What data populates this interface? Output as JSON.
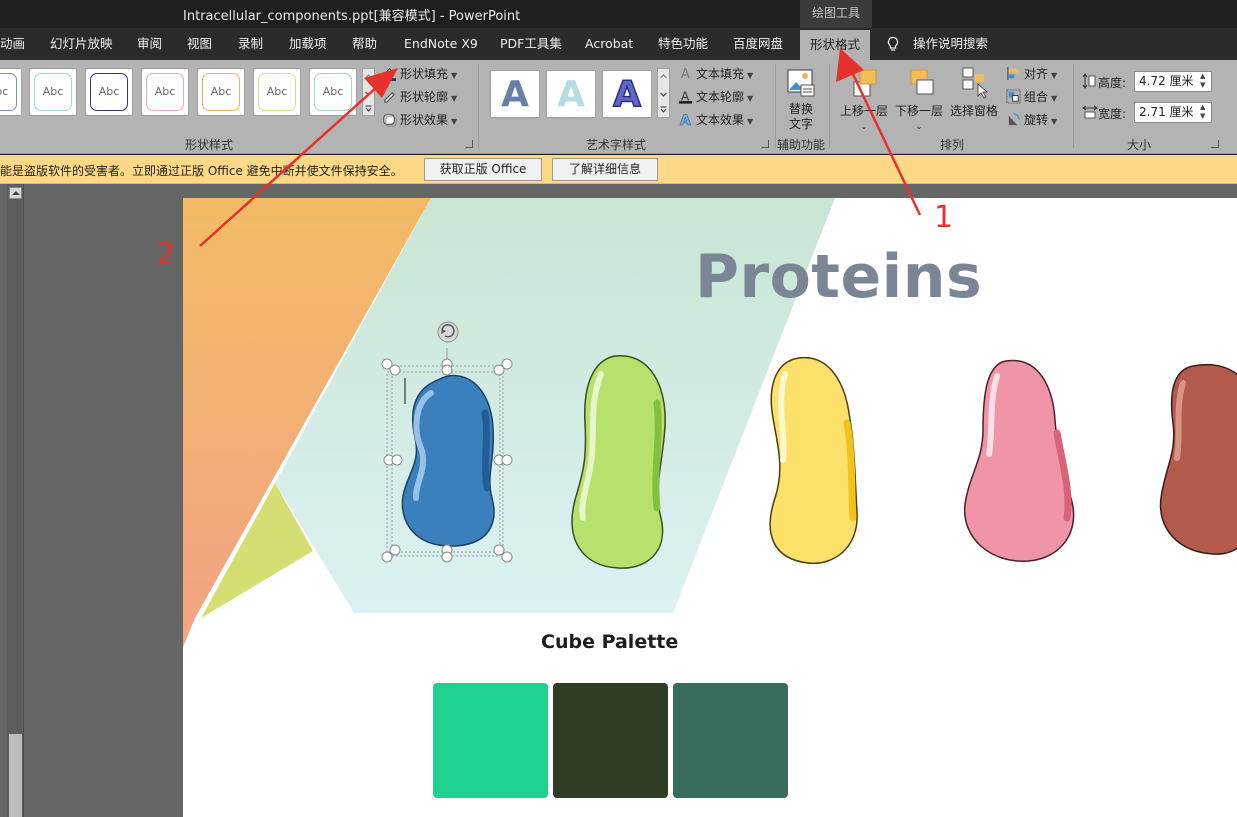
{
  "window": {
    "title": "Intracellular_components.ppt[兼容模式]  -  PowerPoint",
    "context_group": "绘图工具"
  },
  "tabs": [
    {
      "label": "动画",
      "active": false
    },
    {
      "label": "幻灯片放映",
      "active": false
    },
    {
      "label": "审阅",
      "active": false
    },
    {
      "label": "视图",
      "active": false
    },
    {
      "label": "录制",
      "active": false
    },
    {
      "label": "加载项",
      "active": false
    },
    {
      "label": "帮助",
      "active": false
    },
    {
      "label": "EndNote X9",
      "active": false
    },
    {
      "label": "PDF工具集",
      "active": false
    },
    {
      "label": "Acrobat",
      "active": false
    },
    {
      "label": "特色功能",
      "active": false
    },
    {
      "label": "百度网盘",
      "active": false
    },
    {
      "label": "形状格式",
      "active": true
    }
  ],
  "tell_me": "操作说明搜索",
  "ribbon": {
    "shape_styles": {
      "label": "形状样式",
      "swatch_text": "Abc",
      "swatch_colors": [
        "#7b8fc7",
        "#9ed3dc",
        "#2f3580",
        "#f0a7b2",
        "#f2b25a",
        "#d7e07c",
        "#a8d3ba"
      ],
      "fill": "形状填充",
      "outline": "形状轮廓",
      "effects": "形状效果"
    },
    "wordart_styles": {
      "label": "艺术字样式",
      "letter": "A",
      "text_fill": "文本填充",
      "text_outline": "文本轮廓",
      "text_effects": "文本效果"
    },
    "accessibility": {
      "label": "辅助功能",
      "alt_text_line1": "替换",
      "alt_text_line2": "文字"
    },
    "arrange": {
      "label": "排列",
      "bring_forward": "上移一层",
      "send_backward": "下移一层",
      "selection_pane": "选择窗格",
      "align": "对齐",
      "group": "组合",
      "rotate": "旋转"
    },
    "size": {
      "label": "大小",
      "height_label": "高度:",
      "height_value": "4.72 厘米",
      "width_label": "宽度:",
      "width_value": "2.71 厘米"
    }
  },
  "infobar": {
    "message": "能是盗版软件的受害者。立即通过正版 Office 避免中断并使文件保持安全。",
    "get_genuine": "获取正版 Office",
    "learn_more": "了解详细信息"
  },
  "slide": {
    "title": "Proteins",
    "palette_title": "Cube Palette",
    "palette_colors": [
      "#1fd18f",
      "#2f3d25",
      "#376b5e"
    ],
    "bean_colors": [
      "#3a80bd",
      "#b7e06c",
      "#fde06a",
      "#f095a7",
      "#b25b4d"
    ]
  },
  "annotations": {
    "arrow_color": "#e5322d",
    "marker_1": "1",
    "marker_2": "2"
  }
}
